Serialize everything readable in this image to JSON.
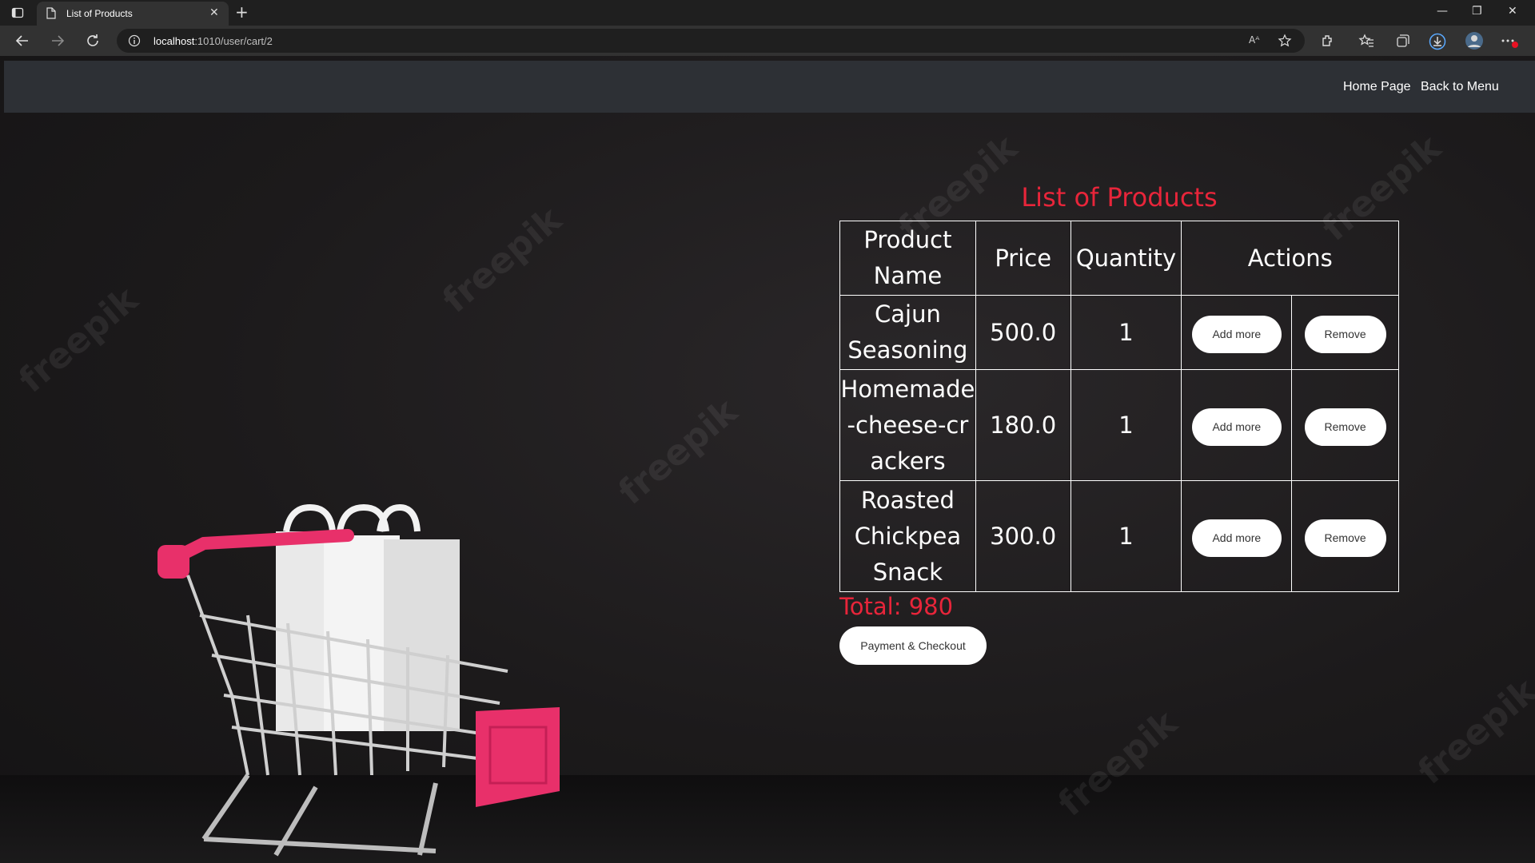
{
  "browser": {
    "tab_title": "List of Products",
    "url_host": "localhost",
    "url_path": ":1010/user/cart/2",
    "read_aloud": "Aᴬ"
  },
  "nav": {
    "home": "Home Page",
    "back": "Back to Menu"
  },
  "watermark": "freepik",
  "heading": "List of Products",
  "table": {
    "headers": [
      "Product Name",
      "Price",
      "Quantity",
      "Actions"
    ],
    "rows": [
      {
        "name": "Cajun Seasoning",
        "price": "500.0",
        "qty": "1"
      },
      {
        "name": "Homemade-cheese-crackers",
        "price": "180.0",
        "qty": "1"
      },
      {
        "name": "Roasted Chickpea Snack",
        "price": "300.0",
        "qty": "1"
      }
    ],
    "add_label": "Add more",
    "remove_label": "Remove"
  },
  "total": "Total: 980",
  "checkout_label": "Payment & Checkout",
  "colors": {
    "accent": "#e8253a",
    "navbar": "#2d3035",
    "cart_pink": "#e8306a"
  }
}
